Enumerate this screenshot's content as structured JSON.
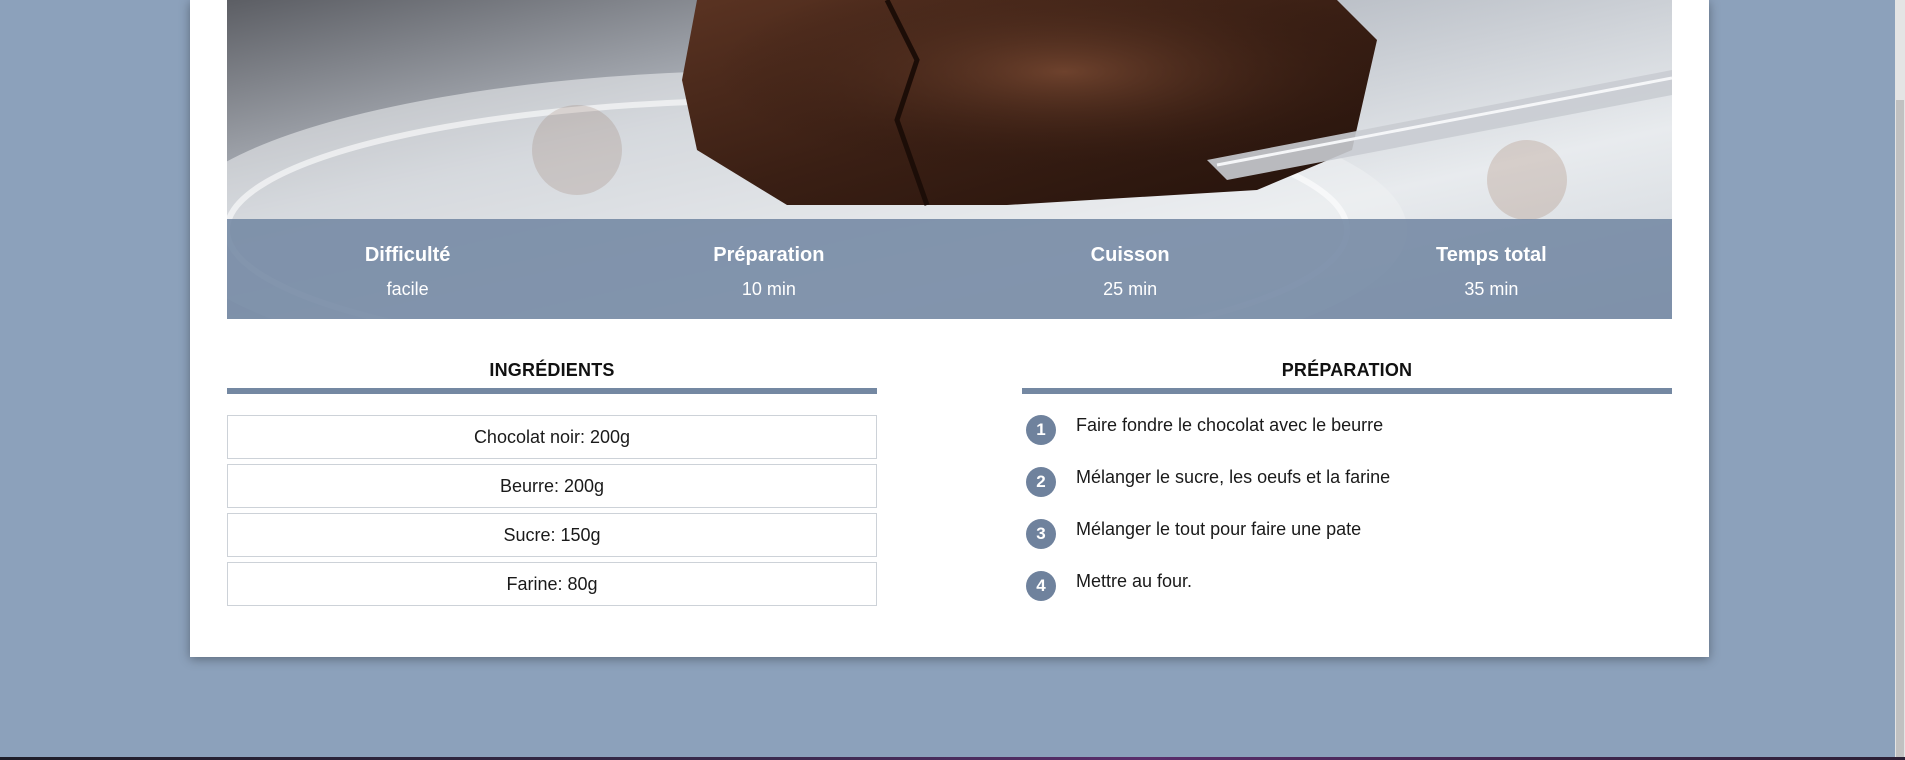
{
  "hero": {
    "stats": [
      {
        "title": "Difficulté",
        "value": "facile"
      },
      {
        "title": "Préparation",
        "value": "10 min"
      },
      {
        "title": "Cuisson",
        "value": "25 min"
      },
      {
        "title": "Temps total",
        "value": "35 min"
      }
    ]
  },
  "ingredients": {
    "title": "INGRÉDIENTS",
    "items": [
      "Chocolat noir: 200g",
      "Beurre: 200g",
      "Sucre: 150g",
      "Farine: 80g"
    ]
  },
  "preparation": {
    "title": "PRÉPARATION",
    "steps": [
      {
        "num": "1",
        "text": "Faire fondre le chocolat avec le beurre"
      },
      {
        "num": "2",
        "text": "Mélanger le sucre, les oeufs et la farine"
      },
      {
        "num": "3",
        "text": "Mélanger le tout pour faire une pate"
      },
      {
        "num": "4",
        "text": "Mettre au four."
      }
    ]
  },
  "colors": {
    "page_background": "#8ca1bb",
    "accent": "#7488a2",
    "stats_bar": "#7387a3"
  }
}
